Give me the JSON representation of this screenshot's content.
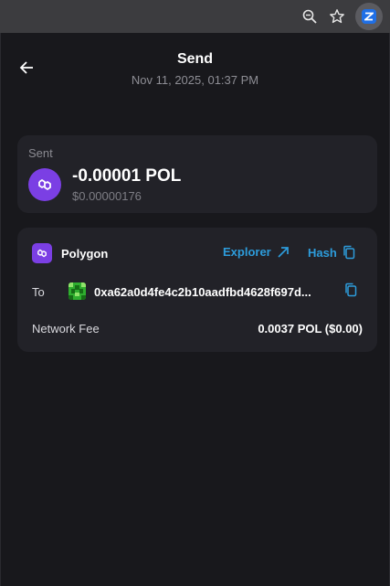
{
  "browser": {
    "icons": [
      "zoom-icon",
      "star-icon",
      "extension-icon"
    ]
  },
  "header": {
    "title": "Send",
    "timestamp": "Nov 11, 2025, 01:37 PM"
  },
  "sent": {
    "label": "Sent",
    "amount": "-0.00001 POL",
    "amount_usd": "$0.00000176",
    "token_icon": "polygon-icon",
    "token_color": "#7b3fe4"
  },
  "details": {
    "network": "Polygon",
    "explorer_label": "Explorer",
    "hash_label": "Hash",
    "to_label": "To",
    "to_address": "0xa62a0d4fe4c2b10aadfbd4628f697d...",
    "fee_label": "Network Fee",
    "fee_value": "0.0037 POL ($0.00)",
    "link_color": "#2d9cdb"
  }
}
